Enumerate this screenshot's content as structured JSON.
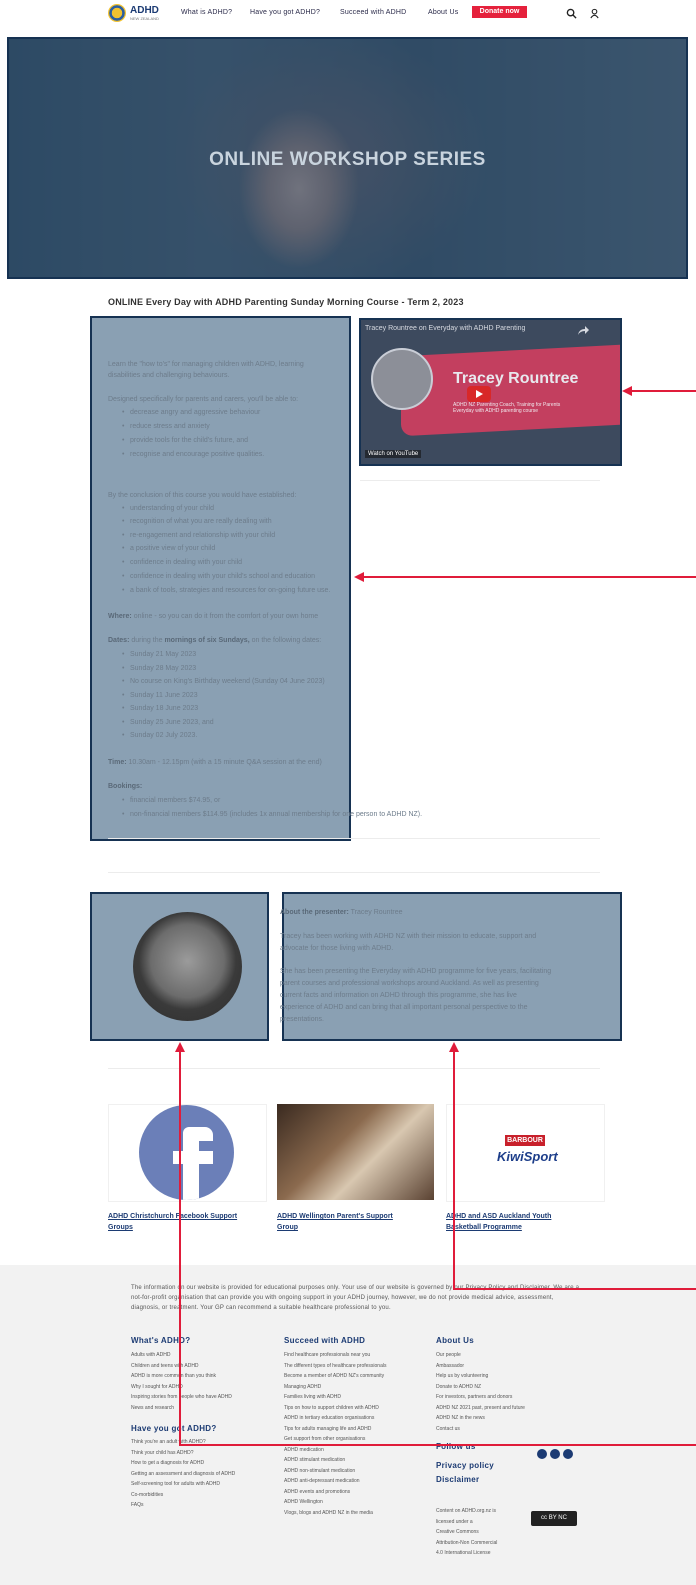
{
  "header": {
    "logo_text": "ADHD",
    "logo_sub": "NEW ZEALAND",
    "nav": [
      "What is ADHD?",
      "Have you got ADHD?",
      "Succeed with ADHD",
      "About Us"
    ],
    "donate": "Donate now"
  },
  "hero": {
    "title": "ONLINE WORKSHOP SERIES"
  },
  "course_title": "ONLINE Every Day with ADHD Parenting Sunday Morning Course - Term 2, 2023",
  "content": {
    "intro": [
      "Learn the \"how to's\" for managing children with ADHD, learning",
      "disabilities and challenging behaviours."
    ],
    "designed": "Designed specifically for parents and carers, you'll be able to:",
    "designed_list": [
      "decrease angry and aggressive behaviour",
      "reduce stress and anxiety",
      "provide tools for the child's future, and",
      "recognise and encourage positive qualities."
    ],
    "conclusion": "By the conclusion of this course you would have established:",
    "conclusion_list": [
      "understanding of your child",
      "recognition of what you are really dealing with",
      "re-engagement and relationship with your child",
      "a positive view of your child",
      "confidence in dealing with your child",
      "confidence in dealing with your child's school and education",
      "a bank of tools, strategies and resources for on-going future use."
    ],
    "where_label": "Where:",
    "where_text": "online - so you can do it from the comfort of your own home",
    "dates_label": "Dates:",
    "dates_pre": "during the",
    "dates_bold": "mornings of six Sundays,",
    "dates_post": "on the following dates:",
    "dates_list": [
      "Sunday 21 May 2023",
      "Sunday 28 May 2023",
      "No course on King's Birthday weekend (Sunday 04 June 2023)",
      "Sunday 11 June 2023",
      "Sunday  18 June 2023",
      "Sunday 25 June 2023, and",
      "Sunday 02 July 2023."
    ],
    "time_label": "Time:",
    "time_text": "10.30am - 12.15pm  (with a 15 minute Q&A session at the end)",
    "bookings_label": "Bookings:",
    "bookings_list": [
      "financial members $74.95, or",
      "non-financial members $114.95 (includes 1x annual membership for one person to ADHD NZ)."
    ]
  },
  "video": {
    "header": "Tracey Rountree on Everyday with ADHD Parenting",
    "name": "Tracey Rountree",
    "sub1": "ADHD NZ Parenting Coach, Training for Parents",
    "sub2": "Everyday with ADHD parenting course",
    "watch": "Watch on YouTube"
  },
  "presenter": {
    "label": "About the presenter:",
    "name": "Tracey Rountree",
    "p1": [
      "Tracey has been working with ADHD NZ with their mission to educate, support and",
      "advocate for those living with ADHD."
    ],
    "p2": [
      "She has been presenting the Everyday with ADHD programme for five years, facilitating",
      "parent courses and professional workshops around Auckland. As well as presenting",
      "current facts and information on ADHD through this programme, she has live",
      "experience of ADHD and can bring that all important personal perspective to the",
      "presentations."
    ]
  },
  "cards": [
    {
      "line1": "ADHD Christchurch Facebook Support",
      "line2": "Groups"
    },
    {
      "line1": "ADHD Wellington Parent's Support",
      "line2": "Group"
    },
    {
      "line1": "ADHD and ASD Auckland Youth",
      "line2": "Basketball Programme"
    }
  ],
  "card3_logo": {
    "top": "BARBOUR",
    "bottom": "KiwiSport"
  },
  "footer": {
    "disclaimer": "The information on our website is provided for educational purposes only. Your use of our website is governed by our Privacy Policy and Disclaimer. We are a not-for-profit organisation that can provide you with ongoing support in your ADHD journey, however, we do not provide medical advice, assessment, diagnosis, or treatment. Your GP can recommend a suitable healthcare professional to you.",
    "col1_head": "What's ADHD?",
    "col1": [
      "Adults with ADHD",
      "Children and teens with ADHD",
      "ADHD is more common than you think",
      "Why I sought for ADHD",
      "Inspiring stories from people who have ADHD",
      "News and research"
    ],
    "col1b_head": "Have you got ADHD?",
    "col1b": [
      "Think you're an adult with ADHD?",
      "Think your child has ADHD?",
      "How to get a diagnosis for ADHD",
      "Getting an assessment and diagnosis of ADHD",
      "Self-screening tool for adults with ADHD",
      "Co-morbidities",
      "FAQs"
    ],
    "col2_head": "Succeed with ADHD",
    "col2": [
      "Find healthcare professionals near you",
      "The different types of healthcare professionals",
      "Become a member of ADHD NZ's community",
      "Managing ADHD",
      "Families living with ADHD",
      "Tips on how to support children with ADHD",
      "ADHD in tertiary education organisations",
      "Tips for adults managing life and ADHD",
      "Get support from other organisations",
      "ADHD medication",
      "ADHD stimulant medication",
      "ADHD non-stimulant medication",
      "ADHD anti-depressant medication",
      "ADHD events and promotions",
      "ADHD Wellington",
      "Vlogs, blogs and ADHD NZ in the media"
    ],
    "col3_head": "About Us",
    "col3": [
      "Our people",
      "Ambassador",
      "Help us by volunteering",
      "Donate to ADHD NZ",
      "For investors, partners and donors",
      "ADHD NZ 2021 past, present and future",
      "ADHD NZ in the news",
      "Contact us"
    ],
    "follow": "Follow us",
    "privacy": "Privacy policy",
    "disclaimer_link": "Disclaimer",
    "license": [
      "Content on ADHD.org.nz is",
      "licensed under a",
      "Creative Commons",
      "Attribution-Non Commercial",
      "4.0 International License"
    ],
    "cc_badge": "cc BY NC"
  },
  "colors": {
    "accent": "#e5213c",
    "brand": "#1c3b73",
    "overlay_border": "#163252",
    "overlay_fill": "#8aa0b3",
    "annotation": "#e01c3a"
  }
}
